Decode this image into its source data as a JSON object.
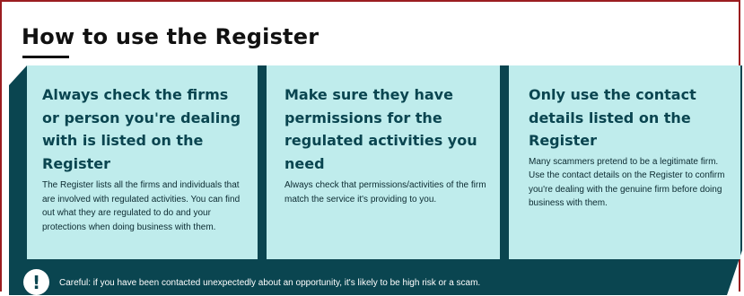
{
  "section": {
    "title": "How to use the Register"
  },
  "cards": [
    {
      "title": "Always check the firms or person you're dealing with is listed on the Register",
      "body": "The Register lists all the firms and individuals that are involved with regulated activities. You can find out what they are regulated to do and your protections when doing business with them."
    },
    {
      "title": "Make sure they have permissions for the regulated activities you need",
      "body": "Always check that permissions/activities of the firm match the service it's providing to you."
    },
    {
      "title": "Only use the contact details listed on the Register",
      "body": "Many scammers pretend to be a legitimate firm. Use the contact details on the Register to confirm you're dealing with the genuine firm before doing business with them."
    }
  ],
  "alert": {
    "icon": "exclamation-circle-icon",
    "icon_glyph": "!",
    "text": "Careful: if you have been contacted unexpectedly about an opportunity, it's likely to be high risk or a scam."
  },
  "colors": {
    "card_background": "#bfecec",
    "band": "#0a4550",
    "heading": "#0a4550",
    "frame_border": "#9b1d20"
  }
}
